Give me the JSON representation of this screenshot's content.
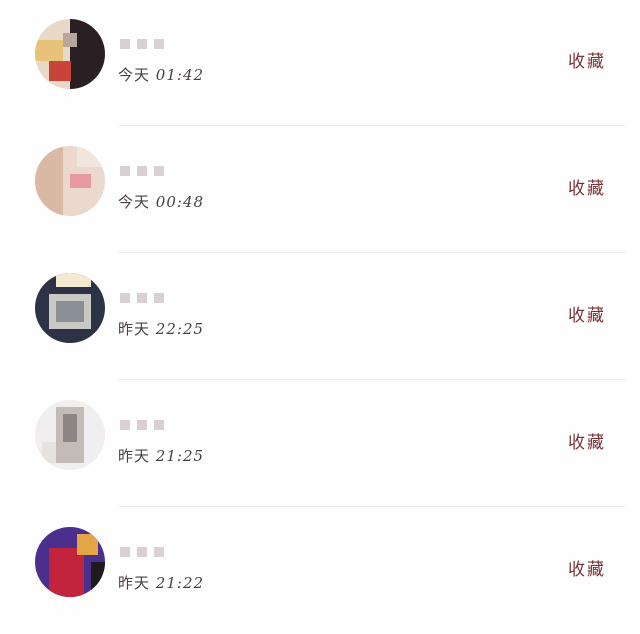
{
  "notifications": [
    {
      "day": "今天",
      "clock": "01:42",
      "action": "收藏",
      "avatar_colors": [
        "#e8d8c8",
        "#2a2024",
        "#c8443a",
        "#e9c27a"
      ]
    },
    {
      "day": "今天",
      "clock": "00:48",
      "action": "收藏",
      "avatar_colors": [
        "#ead9cc",
        "#d9b8a4",
        "#e79aa4",
        "#f0e6dd"
      ]
    },
    {
      "day": "昨天",
      "clock": "22:25",
      "action": "收藏",
      "avatar_colors": [
        "#2d3346",
        "#c9c9c4",
        "#8a8f94",
        "#f4ead2"
      ]
    },
    {
      "day": "昨天",
      "clock": "21:25",
      "action": "收藏",
      "avatar_colors": [
        "#f0eeee",
        "#8b8683",
        "#c3bcb6",
        "#e6e2de"
      ]
    },
    {
      "day": "昨天",
      "clock": "21:22",
      "action": "收藏",
      "avatar_colors": [
        "#4a2f8c",
        "#c2243e",
        "#e3a546",
        "#1f1b1d"
      ]
    }
  ],
  "colors": {
    "action_text": "#7a3338",
    "time_text": "#4a4040",
    "divider": "#eeeeee"
  }
}
